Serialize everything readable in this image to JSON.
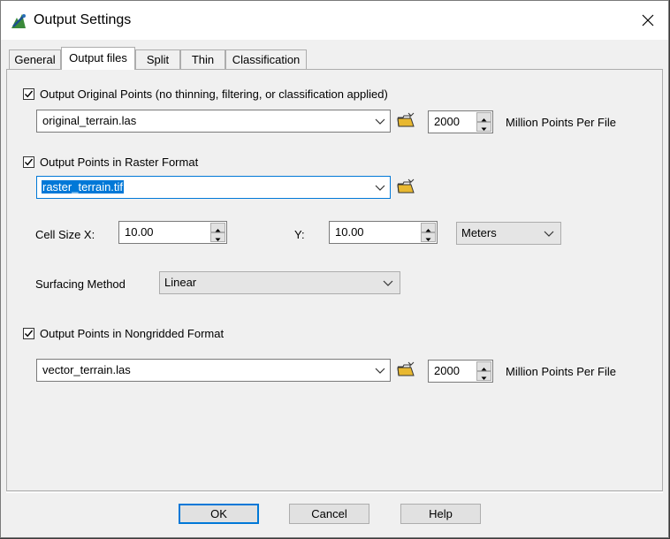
{
  "window": {
    "title": "Output Settings",
    "close_icon": "close-icon"
  },
  "tabs": [
    {
      "label": "General",
      "active": false
    },
    {
      "label": "Output files",
      "active": true
    },
    {
      "label": "Split",
      "active": false
    },
    {
      "label": "Thin",
      "active": false
    },
    {
      "label": "Classification",
      "active": false
    }
  ],
  "original": {
    "checkbox_label": "Output Original Points (no thinning, filtering, or classification applied)",
    "checked": true,
    "file": "original_terrain.las",
    "points_value": "2000",
    "points_label": "Million Points Per File"
  },
  "raster": {
    "checkbox_label": "Output Points in Raster Format",
    "checked": true,
    "file": "raster_terrain.tif",
    "cell_size_x_label": "Cell Size  X:",
    "cell_size_x": "10.00",
    "cell_size_y_label": "Y:",
    "cell_size_y": "10.00",
    "units": "Meters",
    "surfacing_label": "Surfacing Method",
    "surfacing_method": "Linear"
  },
  "nongridded": {
    "checkbox_label": "Output Points in Nongridded Format",
    "checked": true,
    "file": "vector_terrain.las",
    "points_value": "2000",
    "points_label": "Million Points Per File"
  },
  "buttons": {
    "ok": "OK",
    "cancel": "Cancel",
    "help": "Help"
  },
  "colors": {
    "accent": "#0078d7",
    "folder": "#e8b830"
  }
}
